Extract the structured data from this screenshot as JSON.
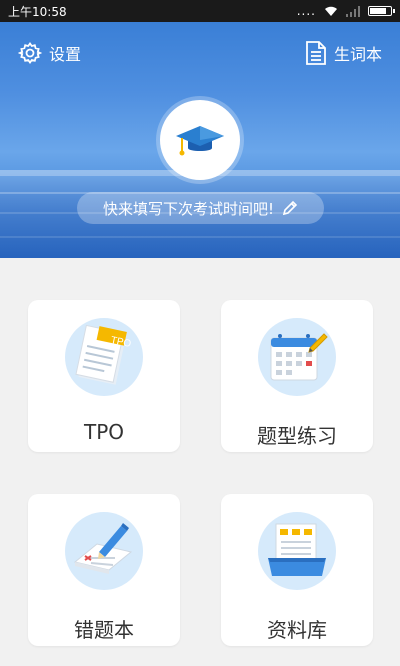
{
  "status_bar": {
    "time": "上午10:58",
    "dots": "...."
  },
  "header": {
    "settings_label": "设置",
    "vocab_label": "生词本",
    "exam_prompt": "快来填写下次考试时间吧!"
  },
  "cards": {
    "tpo": {
      "label": "TPO",
      "badge": "TPO"
    },
    "types": {
      "label": "题型练习"
    },
    "wrong": {
      "label": "错题本"
    },
    "library": {
      "label": "资料库"
    }
  },
  "colors": {
    "accent": "#3a7fd6",
    "icon_bg": "#d6eafb",
    "tpo_badge": "#f5b800"
  }
}
